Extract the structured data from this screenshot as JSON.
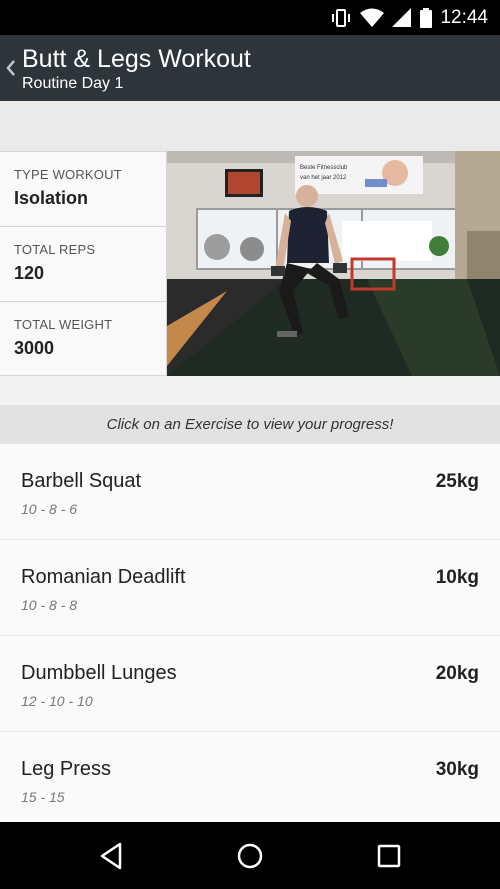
{
  "status_bar": {
    "time": "12:44",
    "icons": [
      "vibrate-icon",
      "wifi-icon",
      "signal-icon",
      "battery-icon"
    ]
  },
  "app_bar": {
    "title": "Butt & Legs Workout",
    "subtitle": "Routine Day 1",
    "back_icon": "chevron-left-icon"
  },
  "stats": [
    {
      "label": "TYPE WORKOUT",
      "value": "Isolation"
    },
    {
      "label": "TOTAL REPS",
      "value": "120"
    },
    {
      "label": "TOTAL WEIGHT",
      "value": "3000"
    }
  ],
  "photo": {
    "banner_line1": "Beste Fitnessclub",
    "banner_line2": "van het jaar 2012"
  },
  "hint": "Click on an Exercise to view your progress!",
  "exercises": [
    {
      "name": "Barbell Squat",
      "reps": "10 - 8 - 6",
      "weight": "25kg"
    },
    {
      "name": "Romanian Deadlift",
      "reps": "10 - 8 - 8",
      "weight": "10kg"
    },
    {
      "name": "Dumbbell Lunges",
      "reps": "12 - 10 - 10",
      "weight": "20kg"
    },
    {
      "name": "Leg Press",
      "reps": "15 - 15",
      "weight": "30kg"
    }
  ],
  "nav_bar": {
    "buttons": [
      "back-triangle-icon",
      "home-circle-icon",
      "recents-square-icon"
    ]
  },
  "colors": {
    "app_bar": "#2d353b",
    "status_bar": "#000000",
    "background": "#f2f2f2"
  }
}
